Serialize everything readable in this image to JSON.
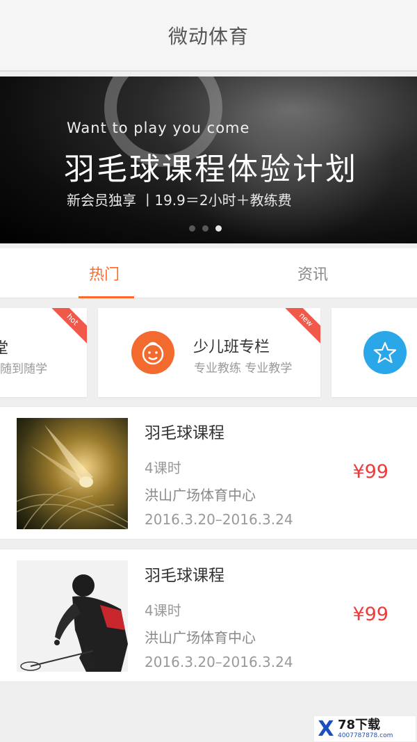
{
  "header": {
    "title": "微动体育"
  },
  "banner": {
    "subtitle": "Want to play you come",
    "headline": "羽毛球课程体验计划",
    "promo": "新会员独享 丨19.9＝2小时＋教练费",
    "slide_count": 3,
    "active_slide": 3
  },
  "tabs": [
    {
      "label": "热门",
      "active": true
    },
    {
      "label": "资讯",
      "active": false
    }
  ],
  "categories": [
    {
      "title": "堂",
      "subtitle": "随到随学",
      "badge": "hot",
      "icon": "course-icon"
    },
    {
      "title": "少儿班专栏",
      "subtitle": "专业教练  专业教学",
      "badge": "new",
      "icon": "child-face-icon",
      "icon_color": "#f26a2e"
    },
    {
      "title": "",
      "subtitle": "",
      "badge": "",
      "icon": "star-icon",
      "icon_color": "#2aa7e8"
    }
  ],
  "courses": [
    {
      "title": "羽毛球课程",
      "hours": "4课时",
      "venue": "洪山广场体育中心",
      "dates": "2016.3.20–2016.3.24",
      "price": "¥99",
      "image": "shuttlecock-photo"
    },
    {
      "title": "羽毛球课程",
      "hours": "4课时",
      "venue": "洪山广场体育中心",
      "dates": "2016.3.20–2016.3.24",
      "price": "¥99",
      "image": "player-photo"
    }
  ],
  "colors": {
    "accent": "#ff6a2b",
    "price": "#f03a3a",
    "badge": "#f0584a"
  },
  "watermark": {
    "mark": "X",
    "brand": "78下载",
    "url": "4007787878.com"
  }
}
